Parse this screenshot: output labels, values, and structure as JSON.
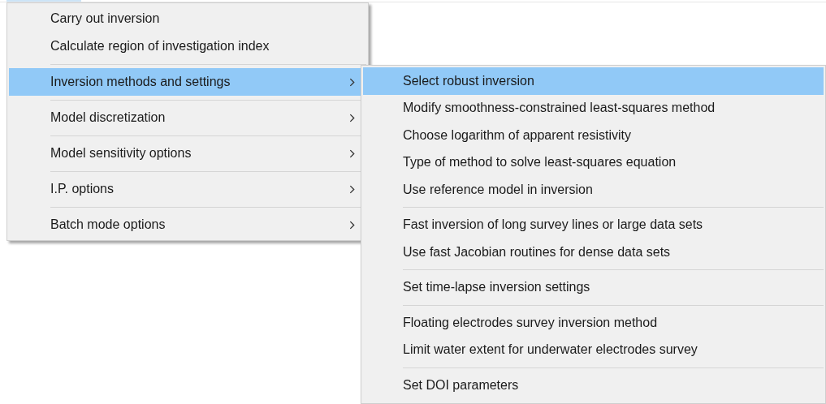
{
  "menu": {
    "groups": [
      [
        {
          "label": "Carry out inversion",
          "selected": false,
          "submenu": false
        },
        {
          "label": "Calculate region of investigation index",
          "selected": false,
          "submenu": false
        }
      ],
      [
        {
          "label": "Inversion methods and settings",
          "selected": true,
          "submenu": true
        }
      ],
      [
        {
          "label": "Model discretization",
          "selected": false,
          "submenu": true
        }
      ],
      [
        {
          "label": "Model sensitivity options",
          "selected": false,
          "submenu": true
        }
      ],
      [
        {
          "label": "I.P. options",
          "selected": false,
          "submenu": true
        }
      ],
      [
        {
          "label": "Batch mode options",
          "selected": false,
          "submenu": true
        }
      ]
    ]
  },
  "submenu": {
    "groups": [
      [
        {
          "label": "Select robust inversion",
          "selected": true
        },
        {
          "label": "Modify smoothness-constrained least-squares method",
          "selected": false
        },
        {
          "label": "Choose logarithm of apparent resistivity",
          "selected": false
        },
        {
          "label": "Type of method to solve least-squares equation",
          "selected": false
        },
        {
          "label": "Use reference model in inversion",
          "selected": false
        }
      ],
      [
        {
          "label": "Fast inversion of long survey lines or large data sets",
          "selected": false
        },
        {
          "label": "Use fast Jacobian routines for dense data sets",
          "selected": false
        }
      ],
      [
        {
          "label": "Set time-lapse inversion settings",
          "selected": false
        }
      ],
      [
        {
          "label": "Floating electrodes survey inversion method",
          "selected": false
        },
        {
          "label": "Limit water extent for underwater electrodes survey",
          "selected": false
        }
      ],
      [
        {
          "label": "Set DOI parameters",
          "selected": false
        }
      ]
    ]
  }
}
